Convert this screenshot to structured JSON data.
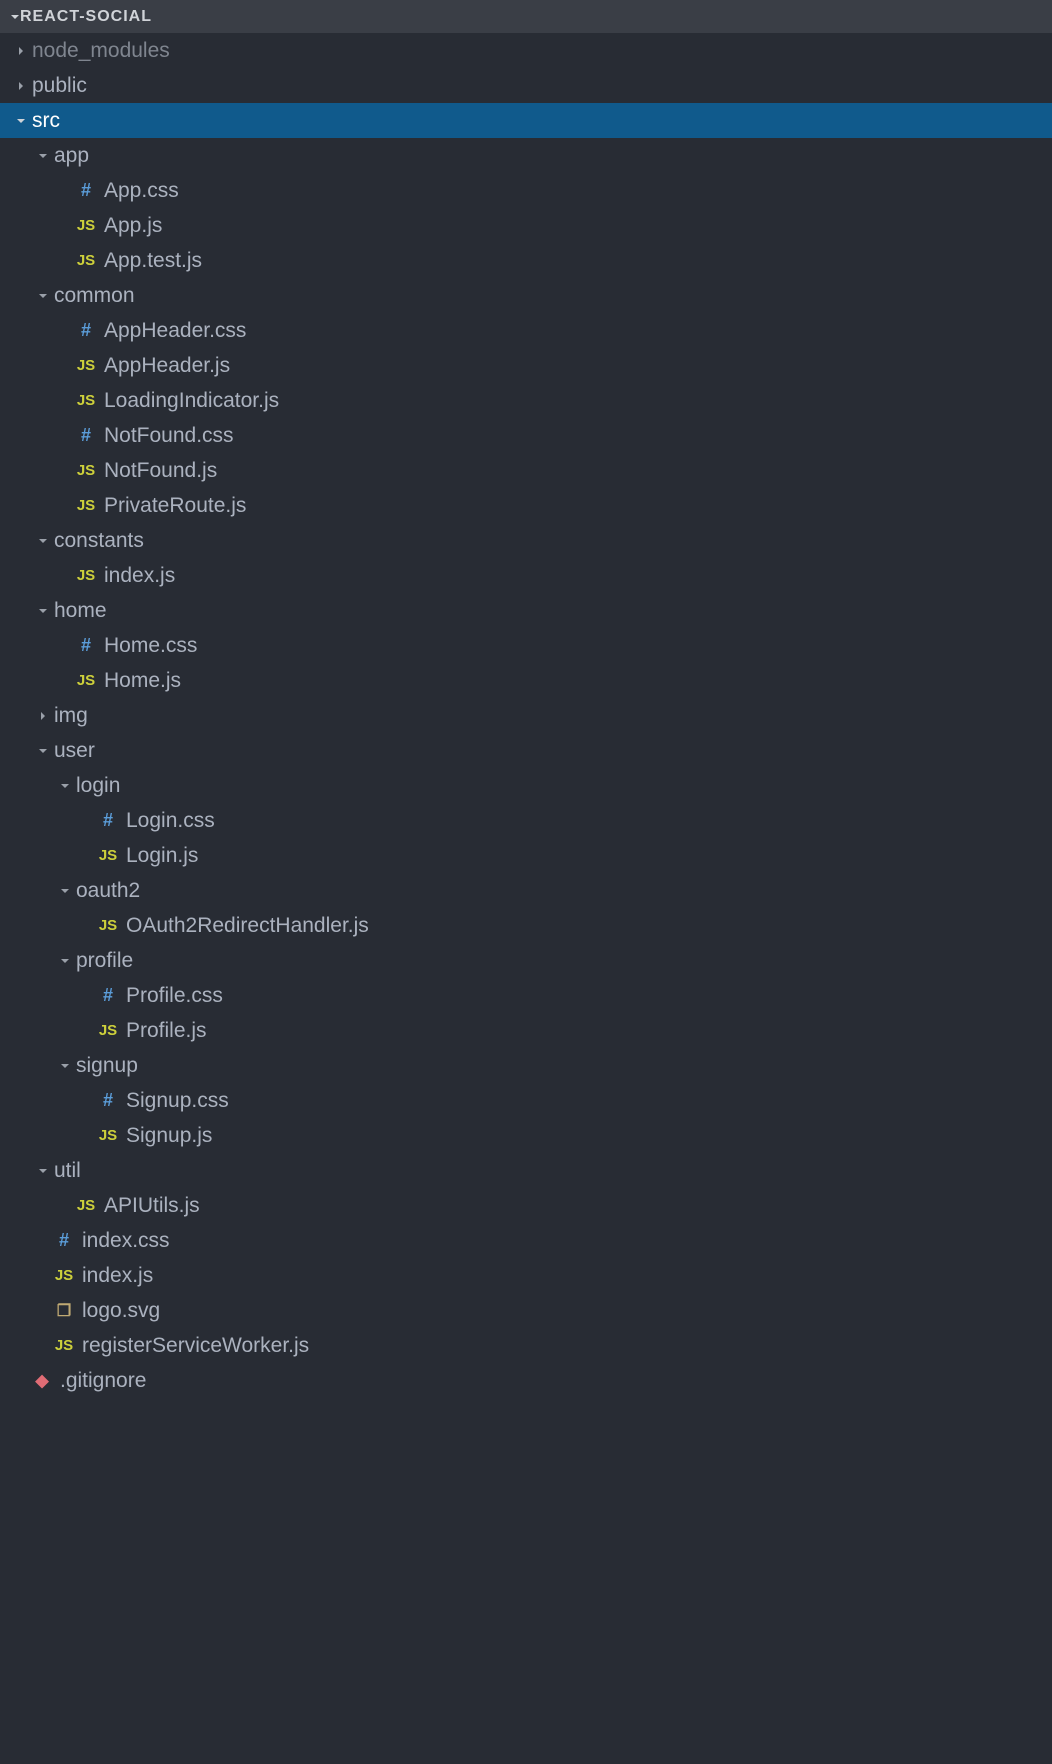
{
  "header": {
    "title": "REACT-SOCIAL"
  },
  "tree": [
    {
      "type": "folder",
      "label": "node_modules",
      "depth": 1,
      "expanded": false,
      "selected": false,
      "dim": true
    },
    {
      "type": "folder",
      "label": "public",
      "depth": 1,
      "expanded": false,
      "selected": false
    },
    {
      "type": "folder",
      "label": "src",
      "depth": 1,
      "expanded": true,
      "selected": true
    },
    {
      "type": "folder",
      "label": "app",
      "depth": 2,
      "expanded": true
    },
    {
      "type": "file",
      "label": "App.css",
      "depth": 3,
      "ftype": "css"
    },
    {
      "type": "file",
      "label": "App.js",
      "depth": 3,
      "ftype": "js"
    },
    {
      "type": "file",
      "label": "App.test.js",
      "depth": 3,
      "ftype": "js"
    },
    {
      "type": "folder",
      "label": "common",
      "depth": 2,
      "expanded": true
    },
    {
      "type": "file",
      "label": "AppHeader.css",
      "depth": 3,
      "ftype": "css"
    },
    {
      "type": "file",
      "label": "AppHeader.js",
      "depth": 3,
      "ftype": "js"
    },
    {
      "type": "file",
      "label": "LoadingIndicator.js",
      "depth": 3,
      "ftype": "js"
    },
    {
      "type": "file",
      "label": "NotFound.css",
      "depth": 3,
      "ftype": "css"
    },
    {
      "type": "file",
      "label": "NotFound.js",
      "depth": 3,
      "ftype": "js"
    },
    {
      "type": "file",
      "label": "PrivateRoute.js",
      "depth": 3,
      "ftype": "js"
    },
    {
      "type": "folder",
      "label": "constants",
      "depth": 2,
      "expanded": true
    },
    {
      "type": "file",
      "label": "index.js",
      "depth": 3,
      "ftype": "js"
    },
    {
      "type": "folder",
      "label": "home",
      "depth": 2,
      "expanded": true
    },
    {
      "type": "file",
      "label": "Home.css",
      "depth": 3,
      "ftype": "css"
    },
    {
      "type": "file",
      "label": "Home.js",
      "depth": 3,
      "ftype": "js"
    },
    {
      "type": "folder",
      "label": "img",
      "depth": 2,
      "expanded": false
    },
    {
      "type": "folder",
      "label": "user",
      "depth": 2,
      "expanded": true
    },
    {
      "type": "folder",
      "label": "login",
      "depth": 3,
      "expanded": true
    },
    {
      "type": "file",
      "label": "Login.css",
      "depth": 4,
      "ftype": "css"
    },
    {
      "type": "file",
      "label": "Login.js",
      "depth": 4,
      "ftype": "js"
    },
    {
      "type": "folder",
      "label": "oauth2",
      "depth": 3,
      "expanded": true
    },
    {
      "type": "file",
      "label": "OAuth2RedirectHandler.js",
      "depth": 4,
      "ftype": "js"
    },
    {
      "type": "folder",
      "label": "profile",
      "depth": 3,
      "expanded": true
    },
    {
      "type": "file",
      "label": "Profile.css",
      "depth": 4,
      "ftype": "css"
    },
    {
      "type": "file",
      "label": "Profile.js",
      "depth": 4,
      "ftype": "js"
    },
    {
      "type": "folder",
      "label": "signup",
      "depth": 3,
      "expanded": true
    },
    {
      "type": "file",
      "label": "Signup.css",
      "depth": 4,
      "ftype": "css"
    },
    {
      "type": "file",
      "label": "Signup.js",
      "depth": 4,
      "ftype": "js"
    },
    {
      "type": "folder",
      "label": "util",
      "depth": 2,
      "expanded": true
    },
    {
      "type": "file",
      "label": "APIUtils.js",
      "depth": 3,
      "ftype": "js"
    },
    {
      "type": "file",
      "label": "index.css",
      "depth": 2,
      "ftype": "css"
    },
    {
      "type": "file",
      "label": "index.js",
      "depth": 2,
      "ftype": "js"
    },
    {
      "type": "file",
      "label": "logo.svg",
      "depth": 2,
      "ftype": "svg"
    },
    {
      "type": "file",
      "label": "registerServiceWorker.js",
      "depth": 2,
      "ftype": "js"
    },
    {
      "type": "file",
      "label": ".gitignore",
      "depth": 1,
      "ftype": "git"
    }
  ],
  "icons": {
    "js_badge": "JS",
    "css_badge": "#",
    "svg_badge": "❐",
    "git_badge": "◆"
  }
}
